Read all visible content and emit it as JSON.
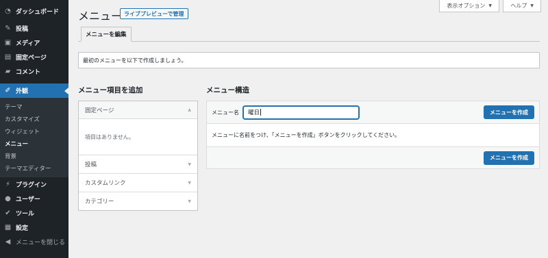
{
  "sidebar": {
    "top": [
      {
        "label": "ダッシュボード",
        "icon": "dashboard-icon"
      },
      {
        "label": "投稿",
        "icon": "pin-icon"
      },
      {
        "label": "メディア",
        "icon": "media-icon"
      },
      {
        "label": "固定ページ",
        "icon": "page-icon"
      },
      {
        "label": "コメント",
        "icon": "comment-icon"
      }
    ],
    "active": {
      "label": "外観",
      "icon": "brush-icon"
    },
    "submenu": [
      "テーマ",
      "カスタマイズ",
      "ウィジェット",
      "メニュー",
      "背景",
      "テーマエディター"
    ],
    "current_sub_index": 3,
    "bottom": [
      {
        "label": "プラグイン",
        "icon": "plugin-icon"
      },
      {
        "label": "ユーザー",
        "icon": "user-icon"
      },
      {
        "label": "ツール",
        "icon": "wrench-icon"
      },
      {
        "label": "設定",
        "icon": "settings-icon"
      }
    ],
    "collapse_label": "メニューを閉じる"
  },
  "top_buttons": {
    "screen_options": "表示オプション",
    "help": "ヘルプ"
  },
  "header": {
    "title": "メニュー",
    "live_preview": "ライブプレビューで管理"
  },
  "tabs": {
    "edit_menus": "メニューを編集"
  },
  "notice": "最初のメニューを以下で作成しましょう。",
  "add_items": {
    "heading": "メニュー項目を追加",
    "sections": [
      {
        "label": "固定ページ",
        "open": true,
        "empty_text": "項目はありません。"
      },
      {
        "label": "投稿",
        "open": false
      },
      {
        "label": "カスタムリンク",
        "open": false
      },
      {
        "label": "カテゴリー",
        "open": false
      }
    ]
  },
  "menu_structure": {
    "heading": "メニュー構造",
    "name_label": "メニュー名",
    "name_value": "曜日",
    "create_button": "メニューを作成",
    "instructions": "メニューに名前をつけ、「メニューを作成」ボタンをクリックしてください。",
    "create_button_bottom": "メニューを作成"
  },
  "colors": {
    "sidebar_bg": "#1d2327",
    "accent": "#2271b1",
    "page_bg": "#f0f0f1"
  }
}
